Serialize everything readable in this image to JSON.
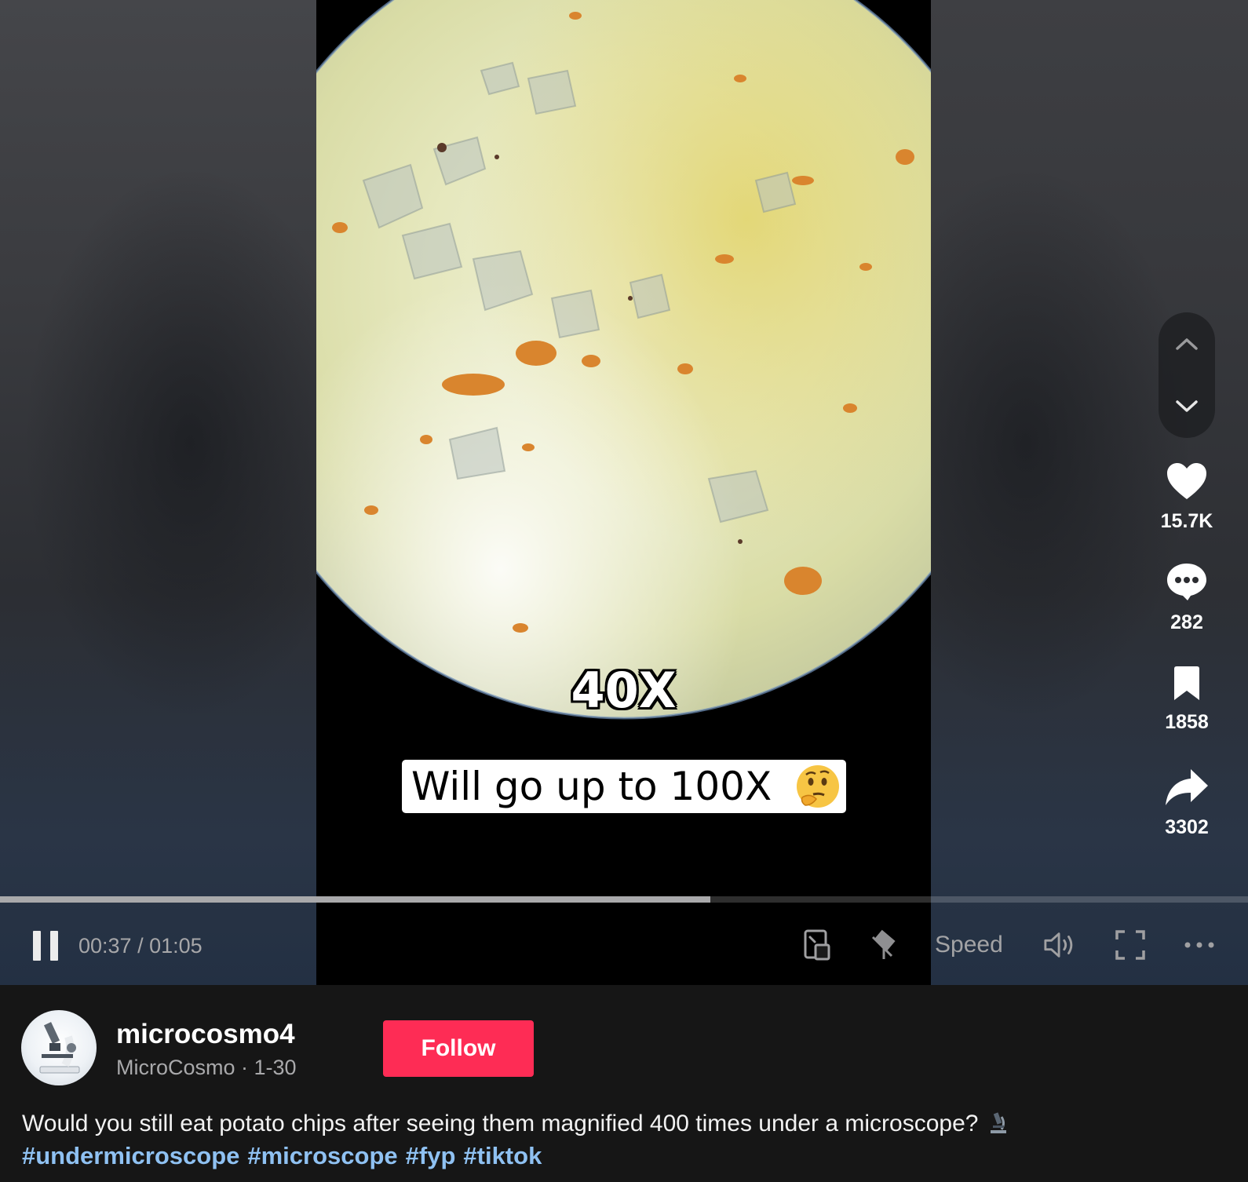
{
  "video": {
    "caption_magnification": "40X",
    "caption_text": "Will go up to 100X",
    "caption_emoji": "thinking-face-emoji"
  },
  "actions": {
    "likes": "15.7K",
    "comments": "282",
    "saves": "1858",
    "shares": "3302"
  },
  "player": {
    "time": "00:37 / 01:05",
    "progress_fraction": 0.569,
    "speed_label": "Speed"
  },
  "author": {
    "username": "microcosmo4",
    "meta": "MicroCosmo · 1-30",
    "follow_label": "Follow"
  },
  "post": {
    "description": "Would you still eat potato chips after seeing them magnified 400 times under a microscope?",
    "hashtags": [
      "#undermicroscope",
      "#microscope",
      "#fyp",
      "#tiktok"
    ]
  },
  "colors": {
    "accent": "#fe2c55",
    "hashtag": "#8fc1f2",
    "panel_bg": "#161616"
  },
  "icons": [
    "chevron-up-icon",
    "chevron-down-icon",
    "heart-icon",
    "comment-icon",
    "bookmark-icon",
    "share-icon",
    "pause-icon",
    "mini-player-icon",
    "floating-player-icon",
    "volume-icon",
    "fullscreen-icon",
    "more-icon",
    "microscope-emoji"
  ]
}
